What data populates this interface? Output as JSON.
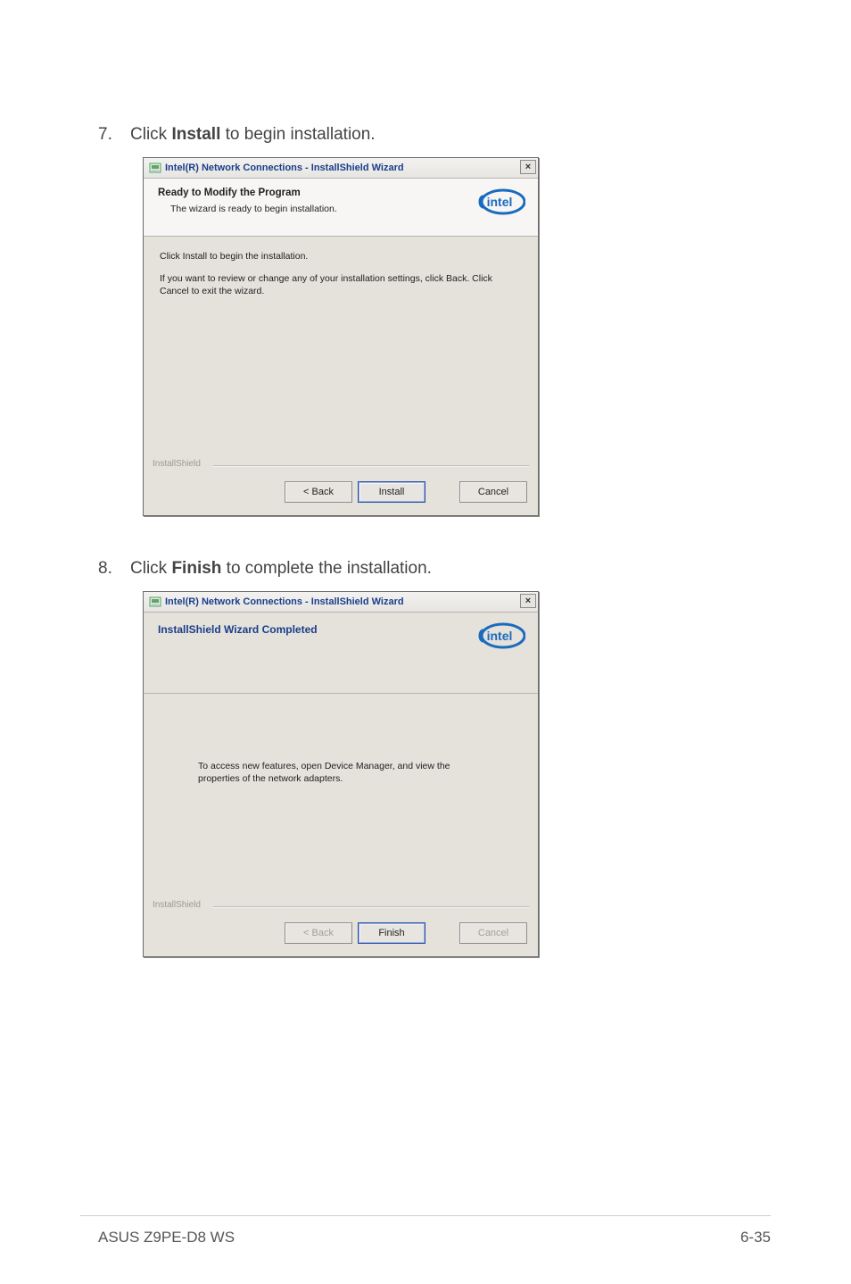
{
  "steps": {
    "s7": {
      "num": "7.",
      "prefix": "Click ",
      "bold": "Install",
      "suffix": " to begin installation."
    },
    "s8": {
      "num": "8.",
      "prefix": "Click ",
      "bold": "Finish",
      "suffix": " to complete the installation."
    }
  },
  "dialog1": {
    "title": "Intel(R) Network Connections - InstallShield Wizard",
    "close": "×",
    "header_title": "Ready to Modify the Program",
    "header_sub": "The wizard is ready to begin installation.",
    "body_line1": "Click Install to begin the installation.",
    "body_line2": "If you want to review or change any of your installation settings, click Back. Click Cancel to exit the wizard.",
    "brand": "InstallShield",
    "buttons": {
      "back": "< Back",
      "install": "Install",
      "cancel": "Cancel"
    }
  },
  "dialog2": {
    "title": "Intel(R) Network Connections - InstallShield Wizard",
    "close": "×",
    "header_title": "InstallShield Wizard Completed",
    "body_msg": "To access new features, open Device Manager, and view the properties of the network adapters.",
    "brand": "InstallShield",
    "buttons": {
      "back": "< Back",
      "finish": "Finish",
      "cancel": "Cancel"
    }
  },
  "footer": {
    "left": "ASUS Z9PE-D8 WS",
    "right": "6-35"
  },
  "icons": {
    "installer": "installer-icon",
    "close": "close-icon",
    "intel": "intel-logo"
  }
}
